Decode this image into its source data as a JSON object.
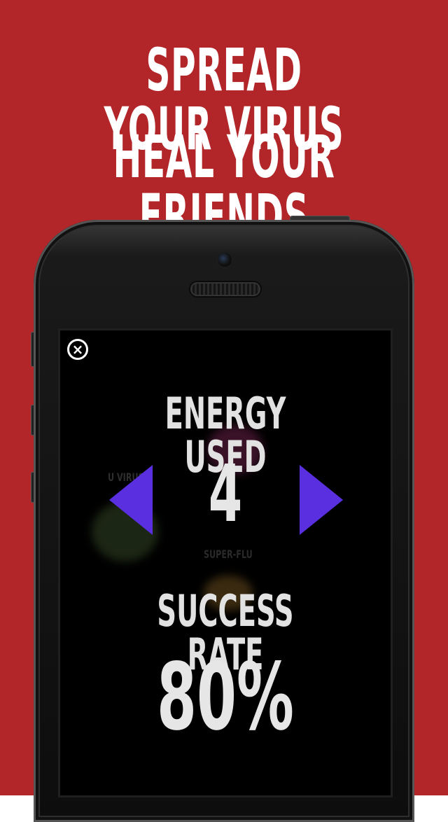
{
  "headline": {
    "line1": "SPREAD YOUR VIRUS",
    "line2": "HEAL YOUR FRIENDS"
  },
  "colors": {
    "background": "#b22629",
    "arrow": "#5a2fe0",
    "text": "#ffffff"
  },
  "screen": {
    "close_icon": "×",
    "energy_label": "ENERGY USED",
    "energy_value": "4",
    "success_label": "SUCCESS RATE",
    "success_value": "80%",
    "background_hint_1": "U VIRUS",
    "background_hint_2": "SUPER-FLU"
  },
  "icons": [
    "close-icon",
    "arrow-left-icon",
    "arrow-right-icon"
  ]
}
